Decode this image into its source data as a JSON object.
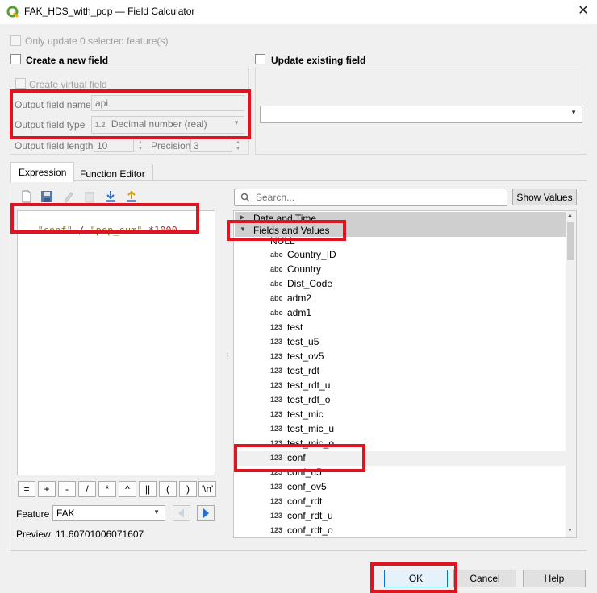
{
  "window": {
    "title": "FAK_HDS_with_pop — Field Calculator",
    "close_icon": "close-icon"
  },
  "options": {
    "only_selected": "Only update 0 selected feature(s)",
    "create_new_field": "Create a new field",
    "update_existing": "Update existing field",
    "create_virtual": "Create virtual field"
  },
  "new_field": {
    "name_label": "Output field name",
    "name_value": "api",
    "type_label": "Output field type",
    "type_badge": "1.2",
    "type_value": "Decimal number (real)",
    "length_label": "Output field length",
    "length_value": "10",
    "precision_label": "Precision",
    "precision_value": "3"
  },
  "existing_field": {
    "selected": ""
  },
  "tabs": [
    {
      "label": "Expression",
      "active": true
    },
    {
      "label": "Function Editor",
      "active": false
    }
  ],
  "expression": {
    "tokens": [
      {
        "text": "\"conf\"",
        "kind": "str"
      },
      {
        "text": " / ",
        "kind": "op"
      },
      {
        "text": "\"pop_sum\"",
        "kind": "str"
      },
      {
        "text": " *",
        "kind": "op"
      },
      {
        "text": "1000",
        "kind": "num"
      }
    ]
  },
  "operators": [
    "=",
    "+",
    "-",
    "/",
    "*",
    "^",
    "||",
    "(",
    ")",
    "'\\n'"
  ],
  "feature": {
    "label": "Feature",
    "value": "FAK"
  },
  "preview": {
    "label": "Preview:",
    "value": "11.60701006071607"
  },
  "search": {
    "placeholder": "Search...",
    "show_values": "Show Values"
  },
  "tree": {
    "group_collapsed": "Date and Time",
    "group_expanded": "Fields and Values",
    "null_item": "NULL",
    "fields": [
      {
        "type": "abc",
        "name": "Country_ID"
      },
      {
        "type": "abc",
        "name": "Country"
      },
      {
        "type": "abc",
        "name": "Dist_Code"
      },
      {
        "type": "abc",
        "name": "adm2"
      },
      {
        "type": "abc",
        "name": "adm1"
      },
      {
        "type": "123",
        "name": "test"
      },
      {
        "type": "123",
        "name": "test_u5"
      },
      {
        "type": "123",
        "name": "test_ov5"
      },
      {
        "type": "123",
        "name": "test_rdt"
      },
      {
        "type": "123",
        "name": "test_rdt_u"
      },
      {
        "type": "123",
        "name": "test_rdt_o"
      },
      {
        "type": "123",
        "name": "test_mic"
      },
      {
        "type": "123",
        "name": "test_mic_u"
      },
      {
        "type": "123",
        "name": "test_mic_o"
      },
      {
        "type": "123",
        "name": "conf"
      },
      {
        "type": "123",
        "name": "conf_u5"
      },
      {
        "type": "123",
        "name": "conf_ov5"
      },
      {
        "type": "123",
        "name": "conf_rdt"
      },
      {
        "type": "123",
        "name": "conf_rdt_u"
      },
      {
        "type": "123",
        "name": "conf_rdt_o"
      }
    ],
    "highlighted": "conf"
  },
  "buttons": {
    "ok": "OK",
    "cancel": "Cancel",
    "help": "Help"
  },
  "colors": {
    "annotation": "#e0141e",
    "string": "#7a8a00",
    "number": "#c0302c"
  }
}
